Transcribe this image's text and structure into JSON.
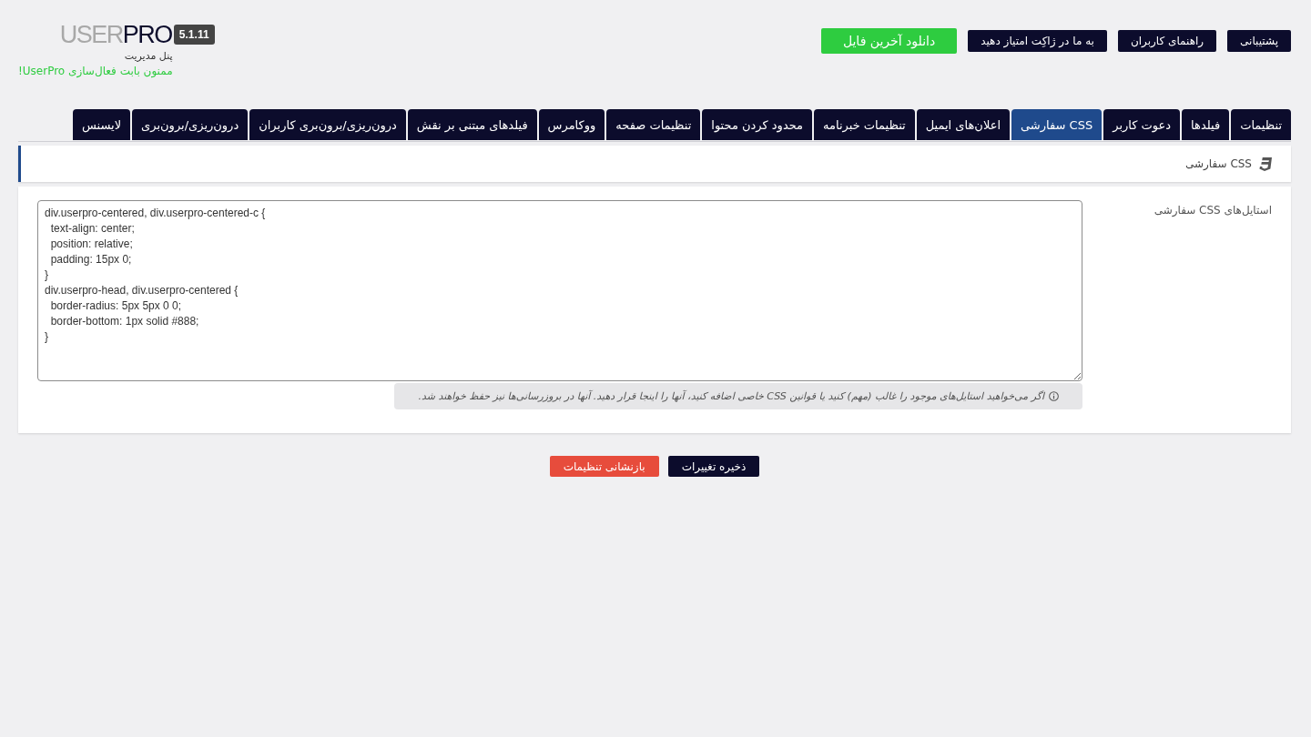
{
  "header": {
    "logo": {
      "light": "USER",
      "dark": "PRO"
    },
    "version": "5.1.11",
    "subtitle": "پنل مدیریت",
    "notice": "ممنون بابت فعال‌سازی UserPro!",
    "buttons": [
      {
        "label": "پشتیبانی",
        "kind": "default"
      },
      {
        "label": "راهنمای کاربران",
        "kind": "default"
      },
      {
        "label": "به ما در ژاکِت امتیاز دهید",
        "kind": "default"
      },
      {
        "label": "دانلود آخرین فایل",
        "kind": "download"
      }
    ]
  },
  "tabs": [
    {
      "label": "تنظیمات",
      "selected": false
    },
    {
      "label": "فیلدها",
      "selected": false
    },
    {
      "label": "دعوت کاربر",
      "selected": false
    },
    {
      "label": "CSS سفارشی",
      "selected": true
    },
    {
      "label": "اعلان‌های ایمیل",
      "selected": false
    },
    {
      "label": "تنظیمات خبرنامه",
      "selected": false
    },
    {
      "label": "محدود کردن محتوا",
      "selected": false
    },
    {
      "label": "تنظیمات صفحه",
      "selected": false
    },
    {
      "label": "ووکامرس",
      "selected": false
    },
    {
      "label": "فیلدهای مبتنی بر نقش",
      "selected": false
    },
    {
      "label": "درون‌ریزی/برون‌بری کاربران",
      "selected": false
    },
    {
      "label": "درون‌ریزی/برون‌بری",
      "selected": false
    },
    {
      "label": "لایسنس",
      "selected": false
    }
  ],
  "section": {
    "title": "CSS سفارشی"
  },
  "field": {
    "label": "استایل‌های CSS سفارشی",
    "value": "div.userpro-centered, div.userpro-centered-c {\n  text-align: center;\n  position: relative;\n  padding: 15px 0;\n}\ndiv.userpro-head, div.userpro-centered {\n  border-radius: 5px 5px 0 0;\n  border-bottom: 1px solid #888;\n}",
    "help": "اگر می‌خواهید استایل‌های موجود را غالب (مهم) کنید یا قوانین CSS خاصی اضافه کنید، آنها را اینجا قرار دهید. آنها در بروزرسانی‌ها نیز حفظ خواهند شد."
  },
  "actions": [
    {
      "label": "ذخیره تغییرات",
      "kind": "save"
    },
    {
      "label": "بازنشانی تنظیمات",
      "kind": "reset"
    }
  ]
}
